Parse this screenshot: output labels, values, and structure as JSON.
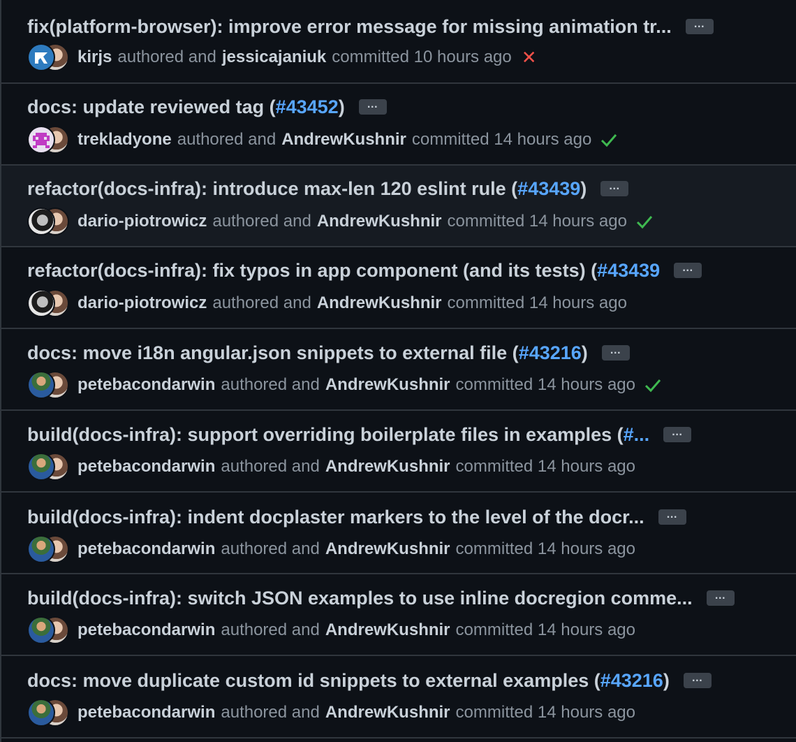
{
  "status_colors": {
    "success": "#3fb950",
    "failure": "#f85149",
    "link": "#58a6ff"
  },
  "commits": [
    {
      "title": "fix(platform-browser): improve error message for missing animation tr...",
      "pr": "",
      "title_suffix": "",
      "author": "kirjs",
      "authored_label": "authored and",
      "committer": "jessicajaniuk",
      "committed_label": "committed 10 hours ago",
      "status": "failure",
      "author_avatar": "kirjs-avatar",
      "more_label": "…"
    },
    {
      "title": "docs: update reviewed tag (",
      "pr": "#43452",
      "title_suffix": ")",
      "author": "trekladyone",
      "authored_label": "authored and",
      "committer": "AndrewKushnir",
      "committed_label": "committed 14 hours ago",
      "status": "success",
      "author_avatar": "trekladyone-avatar",
      "more_label": "…"
    },
    {
      "title": "refactor(docs-infra): introduce max-len 120 eslint rule (",
      "pr": "#43439",
      "title_suffix": ")",
      "author": "dario-piotrowicz",
      "authored_label": "authored and",
      "committer": "AndrewKushnir",
      "committed_label": "committed 14 hours ago",
      "status": "success",
      "author_avatar": "dario-avatar",
      "more_label": "…"
    },
    {
      "title": "refactor(docs-infra): fix typos in app component (and its tests) (",
      "pr": "#43439",
      "title_suffix": "",
      "author": "dario-piotrowicz",
      "authored_label": "authored and",
      "committer": "AndrewKushnir",
      "committed_label": "committed 14 hours ago",
      "status": "",
      "author_avatar": "dario-avatar",
      "more_label": "…"
    },
    {
      "title": "docs: move i18n angular.json snippets to external file (",
      "pr": "#43216",
      "title_suffix": ")",
      "author": "petebacondarwin",
      "authored_label": "authored and",
      "committer": "AndrewKushnir",
      "committed_label": "committed 14 hours ago",
      "status": "success",
      "author_avatar": "pete-avatar",
      "more_label": "…"
    },
    {
      "title": "build(docs-infra): support overriding boilerplate files in examples (",
      "pr": "#...",
      "title_suffix": "",
      "author": "petebacondarwin",
      "authored_label": "authored and",
      "committer": "AndrewKushnir",
      "committed_label": "committed 14 hours ago",
      "status": "",
      "author_avatar": "pete-avatar",
      "more_label": "…"
    },
    {
      "title": "build(docs-infra): indent docplaster markers to the level of the docr...",
      "pr": "",
      "title_suffix": "",
      "author": "petebacondarwin",
      "authored_label": "authored and",
      "committer": "AndrewKushnir",
      "committed_label": "committed 14 hours ago",
      "status": "",
      "author_avatar": "pete-avatar",
      "more_label": "…"
    },
    {
      "title": "build(docs-infra): switch JSON examples to use inline docregion comme...",
      "pr": "",
      "title_suffix": "",
      "author": "petebacondarwin",
      "authored_label": "authored and",
      "committer": "AndrewKushnir",
      "committed_label": "committed 14 hours ago",
      "status": "",
      "author_avatar": "pete-avatar",
      "more_label": "…"
    },
    {
      "title": "docs: move duplicate custom id snippets to external examples (",
      "pr": "#43216",
      "title_suffix": ")",
      "author": "petebacondarwin",
      "authored_label": "authored and",
      "committer": "AndrewKushnir",
      "committed_label": "committed 14 hours ago",
      "status": "",
      "author_avatar": "pete-avatar",
      "more_label": "…"
    }
  ]
}
